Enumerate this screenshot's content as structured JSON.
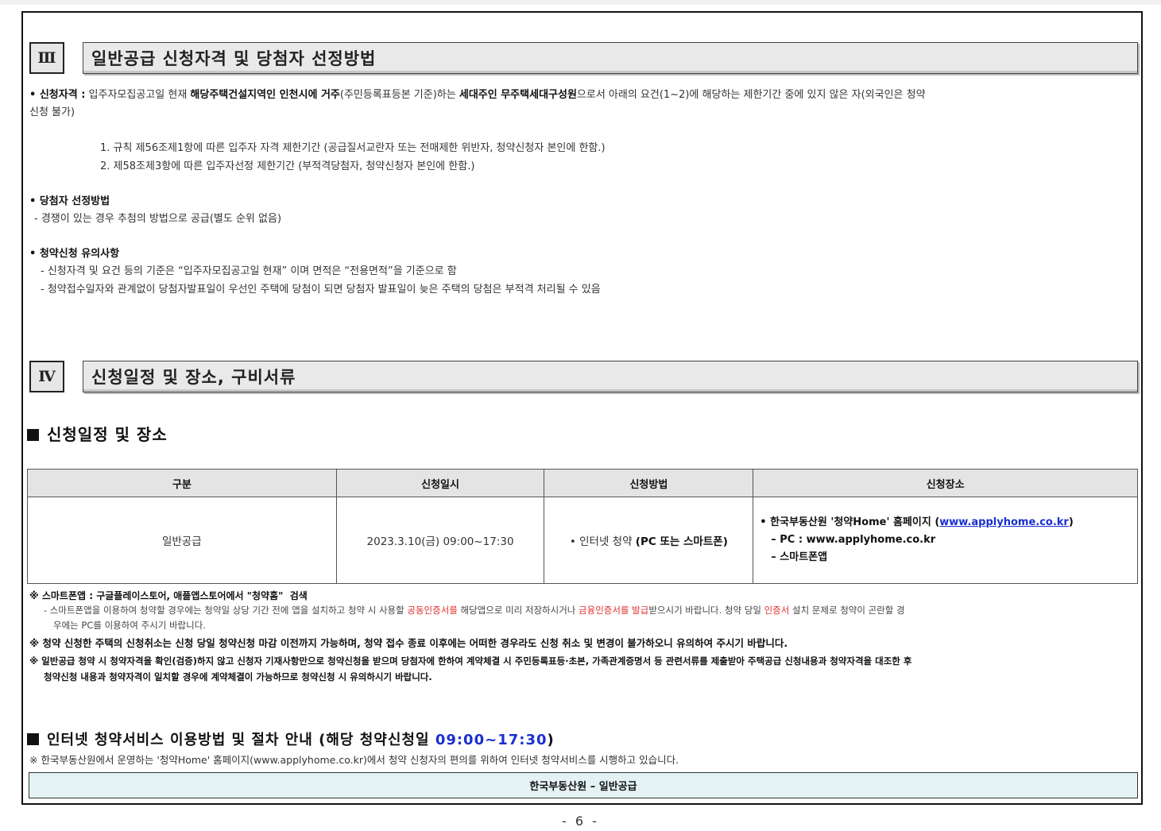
{
  "section3": {
    "roman": "Ⅲ",
    "title": "일반공급 신청자격 및 당첨자 선정방법",
    "eligibility": {
      "label": "• 신청자격 :",
      "t1": "입주자모집공고일 현재",
      "b1": "해당주택건설지역인 인천시에 거주",
      "t2": "(주민등록표등본 기준)하는",
      "b2": "세대주인 무주택세대구성원",
      "t3": "으로서 아래의 요건(1~2)에 해당하는 제한기간 중에 있지 않은 자(외국인은 청약",
      "t4": "신청 불가)"
    },
    "rules": [
      "1. 규칙 제56조제1항에 따른 입주자 자격 제한기간 (공급질서교란자 또는 전매제한 위반자, 청약신청자 본인에 한함.)",
      "2. 제58조제3항에 따른 입주자선정 제한기간 (부적격당첨자, 청약신청자 본인에 한함.)"
    ],
    "winner": {
      "title": "• 당첨자 선정방법",
      "line": "- 경쟁이 있는 경우 추첨의 방법으로 공급(별도 순위 없음)"
    },
    "caution": {
      "title": "• 청약신청 유의사항",
      "lines": [
        "- 신청자격 및 요건 등의 기준은 “입주자모집공고일 현재” 이며 면적은 “전용면적”을 기준으로 함",
        "- 청약접수일자와 관계없이 당첨자발표일이 우선인 주택에 당첨이 되면 당첨자 발표일이 늦은 주택의 당첨은 부적격 처리될 수 있음"
      ]
    }
  },
  "section4": {
    "roman": "Ⅳ",
    "title": "신청일정 및 장소, 구비서류",
    "sub1": "신청일정 및 장소",
    "table": {
      "headers": [
        "구분",
        "신청일시",
        "신청방법",
        "신청장소"
      ],
      "row": {
        "type": "일반공급",
        "datetime": "2023.3.10(금) 09:00~17:30",
        "method_prefix": "• 인터넷 청약",
        "method_bold": "(PC 또는 스마트폰)",
        "place_l1": "• 한국부동산원 '청약Home' 홈페이지 (",
        "place_link": "www.applyhome.co.kr",
        "place_l1_end": ")",
        "place_l2": "– PC : www.applyhome.co.kr",
        "place_l3": "– 스마트폰앱"
      }
    },
    "notes": {
      "n1_prefix": "※ 스마트폰앱 : 구글플레이스토어, 애플앱스토어에서",
      "n1_quote": "\"청약홈\"",
      "n1_suffix": "검색",
      "n1_sub_a": "- 스마트폰앱을 이용하여 청약할 경우에는 청약일 상당 기간 전에 앱을 설치하고 청약 시 사용할 ",
      "n1_sub_red1": "공동인증서를",
      "n1_sub_b": " 해당앱으로 미리 저장하시거나 ",
      "n1_sub_red2": "금융인증서를 발급",
      "n1_sub_c": "받으시기 바랍니다. 청약 당일 ",
      "n1_sub_red3": "인증서",
      "n1_sub_d": " 설치 문제로 청약이 곤란할 경",
      "n1_sub_e": "우에는 PC를 이용하여 주시기 바랍니다.",
      "n2": "※ 청약 신청한 주택의 신청취소는 신청 당일 청약신청 마감 이전까지 가능하며, 청약 접수 종료 이후에는 어떠한 경우라도 신청 취소 및 변경이 불가하오니 유의하여 주시기 바랍니다.",
      "n3a": "※ 일반공급 청약 시 청약자격을 확인(검증)하지 않고 신청자 기재사항만으로 청약신청을 받으며 당첨자에 한하여 계약체결 시 주민등록표등·초본, 가족관계증명서 등 관련서류를 제출받아 주택공급 신청내용과 청약자격을 대조한 후",
      "n3b": "청약신청 내용과 청약자격이 일치할 경우에 계약체결이 가능하므로 청약신청 시 유의하시기 바랍니다."
    },
    "sub2_prefix": "인터넷 청약서비스 이용방법 및 절차 안내 (해당 청약신청일",
    "sub2_time": "09:00~17:30",
    "sub2_suffix": ")",
    "sub2_note": "※ 한국부동산원에서 운영하는 '청약Home' 홈페이지(www.applyhome.co.kr)에서 청약 신청자의 편의를 위하여 인터넷 청약서비스를 시행하고 있습니다.",
    "bottom_bar": "한국부동산원 – 일반공급"
  },
  "page_number": "- 6 -",
  "colors": {
    "link_blue": "#1a2fd0",
    "highlight_red": "#e0312f",
    "bar_bg": "#e4f2f4",
    "header_gray": "#e4e4e4"
  }
}
